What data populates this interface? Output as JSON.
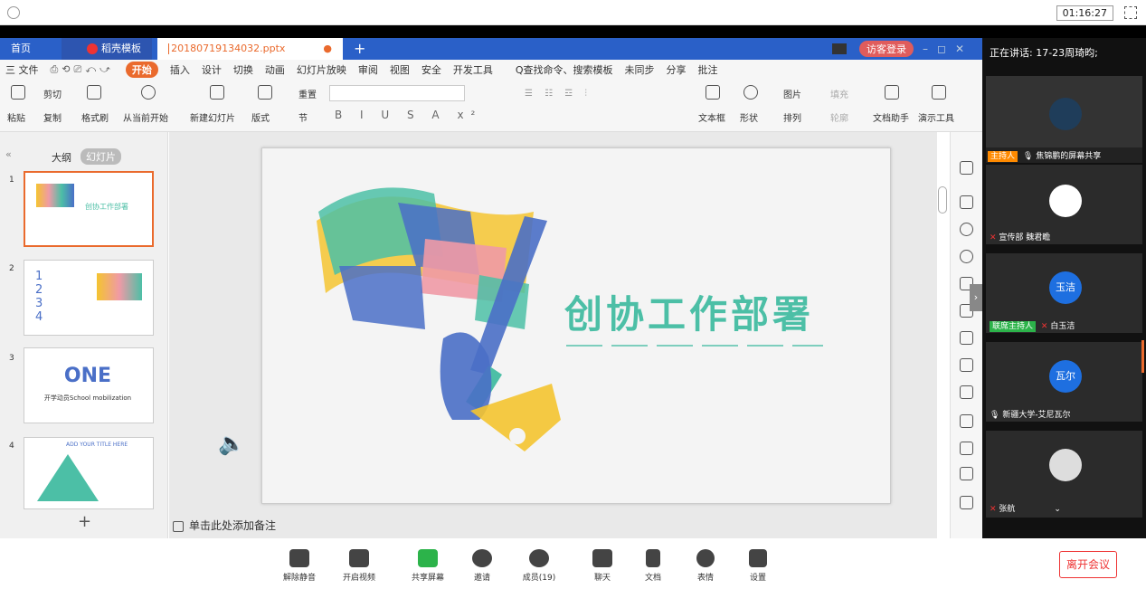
{
  "timer": "01:16:27",
  "tabs": {
    "home": "首页",
    "template": "稻壳模板",
    "file": "20180719134032.pptx",
    "add": "+"
  },
  "guest_login": "访客登录",
  "menu": {
    "file": "三 文件",
    "start": "开始",
    "items": [
      "插入",
      "设计",
      "切换",
      "动画",
      "幻灯片放映",
      "审阅",
      "视图",
      "安全",
      "开发工具"
    ],
    "search": "Q查找命令、搜索模板",
    "unsync": "未同步",
    "share": "分享",
    "comment": "批注"
  },
  "ribbon": {
    "paste": "粘贴",
    "cut": "剪切",
    "copy": "复制",
    "format": "格式刷",
    "from_current": "从当前开始",
    "new_slide": "新建幻灯片",
    "layout": "版式",
    "section": "节",
    "reset": "重置",
    "textbox": "文本框",
    "shape": "形状",
    "arrange": "排列",
    "picture": "图片",
    "fill": "填充",
    "outline": "轮廓",
    "doc_helper": "文档助手",
    "present_tools": "演示工具"
  },
  "leftpane": {
    "outline": "大纲",
    "slides": "幻灯片"
  },
  "thumbs": [
    {
      "num": "1",
      "text": "创协工作部署"
    },
    {
      "num": "2",
      "text": "1 2 3 4"
    },
    {
      "num": "3",
      "text": "ONE",
      "sub": "开学动员School mobilization"
    },
    {
      "num": "4",
      "text": "ADD YOUR TITLE HERE"
    }
  ],
  "slide": {
    "title": "创协工作部署"
  },
  "notes": "单击此处添加备注",
  "rpanel": {
    "speaking": "正在讲话: 17-23周琦昀;",
    "tiles": [
      {
        "badge": "主持人",
        "label": "焦锦鹏的屏幕共享",
        "avatar": ""
      },
      {
        "badge": "",
        "label": "宣传部 魏君瞻",
        "avatar": ""
      },
      {
        "badge": "联席主持人",
        "label": "白玉洁",
        "avatar": "玉洁"
      },
      {
        "badge": "",
        "label": "新疆大学-艾尼瓦尔",
        "avatar": "瓦尔"
      },
      {
        "badge": "",
        "label": "张航",
        "avatar": ""
      }
    ]
  },
  "bottom": {
    "mute": "解除静音",
    "video": "开启视频",
    "share": "共享屏幕",
    "invite": "邀请",
    "members": "成员(19)",
    "chat": "聊天",
    "doc": "文档",
    "emoji": "表情",
    "settings": "设置",
    "leave": "离开会议"
  },
  "colors": {
    "tabbar": "#2a60c8",
    "accent": "#ea6a2d",
    "teal": "#4cbfa6",
    "yellow": "#f4c430",
    "pink": "#ef9aa6",
    "blue": "#4a6fc7",
    "leave": "#e33333",
    "host": "#ff8a00",
    "cohost": "#2cb34a"
  }
}
